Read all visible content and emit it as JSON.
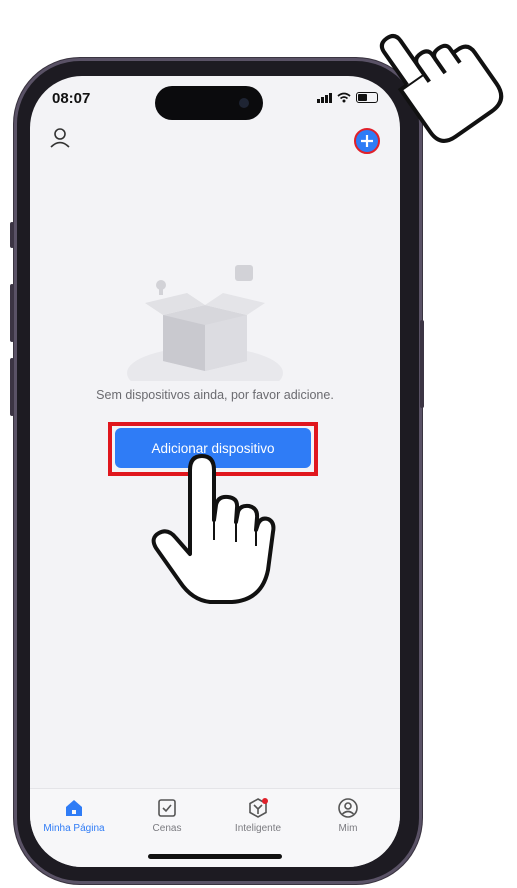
{
  "status_bar": {
    "time": "08:07"
  },
  "header": {
    "profile_icon": "user-icon",
    "add_icon": "plus-icon"
  },
  "empty_state": {
    "message": "Sem dispositivos ainda, por favor adicione.",
    "add_button_label": "Adicionar dispositivo"
  },
  "tab_bar": {
    "tabs": [
      {
        "label": "Minha Página",
        "icon": "home-icon",
        "active": true
      },
      {
        "label": "Cenas",
        "icon": "checkbox-icon",
        "active": false
      },
      {
        "label": "Inteligente",
        "icon": "smart-icon",
        "active": false
      },
      {
        "label": "Mim",
        "icon": "profile-circle-icon",
        "active": false
      }
    ]
  },
  "colors": {
    "accent": "#2f7cf6",
    "highlight": "#e0161d",
    "background": "#f3f3f6"
  }
}
